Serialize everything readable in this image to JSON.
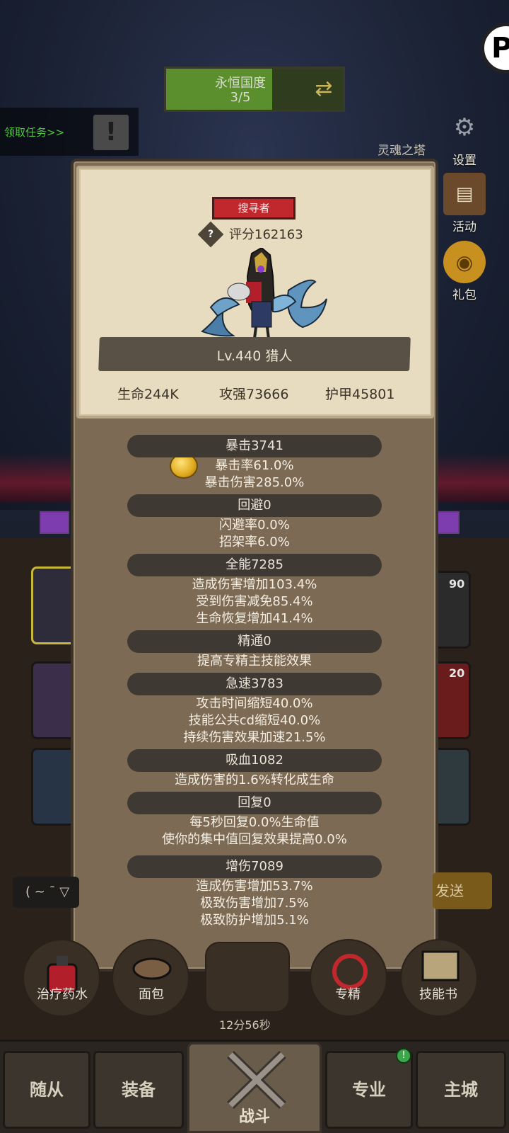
{
  "top": {
    "realm_name": "永恒国度",
    "realm_progress": "3/5",
    "realm_progress_fraction": 0.6,
    "quest_label": "领取任务>>",
    "quest_icon": "exclamation-icon",
    "tower_label": "灵魂之塔",
    "side_menu": [
      {
        "label": "设置",
        "icon": "gear-icon"
      },
      {
        "label": "活动",
        "icon": "scroll-icon"
      },
      {
        "label": "礼包",
        "icon": "gift-bag-icon"
      }
    ],
    "badge_letter": "P"
  },
  "hero_card": {
    "role": "搜寻者",
    "score": "评分162163",
    "help_icon": "?",
    "name_line": "Lv.440 猎人",
    "core_stats": [
      "生命244K",
      "攻强73666",
      "护甲45801"
    ]
  },
  "stat_groups": [
    {
      "title": "暴击3741",
      "lines": [
        "暴击率61.0%",
        "暴击伤害285.0%"
      ]
    },
    {
      "title": "回避0",
      "lines": [
        "闪避率0.0%",
        "招架率6.0%"
      ]
    },
    {
      "title": "全能7285",
      "lines": [
        "造成伤害增加103.4%",
        "受到伤害减免85.4%",
        "生命恢复增加41.4%"
      ]
    },
    {
      "title": "精通0",
      "lines": [
        "提高专精主技能效果"
      ]
    },
    {
      "title": "急速3783",
      "lines": [
        "攻击时间缩短40.0%",
        "技能公共cd缩短40.0%",
        "持续伤害效果加速21.5%"
      ]
    },
    {
      "title": "吸血1082",
      "lines": [
        "造成伤害的1.6%转化成生命"
      ]
    },
    {
      "title": "回复0",
      "lines": [
        "每5秒回复0.0%生命值",
        "使你的集中值回复效果提高0.0%"
      ]
    },
    {
      "title": "增伤7089",
      "lines": [
        "造成伤害增加53.7%",
        "极致伤害增加7.5%",
        "极致防护增加5.1%"
      ]
    }
  ],
  "behind": {
    "chat_text": "( ~ ¯ ▽",
    "send_label": "发送",
    "slot_numbers": [
      "90",
      "20"
    ],
    "consumables": [
      "治疗药水",
      "面包",
      "专精",
      "技能书"
    ],
    "timer": "12分56秒"
  },
  "nav": {
    "items": [
      "随从",
      "装备",
      "战斗",
      "专业",
      "主城"
    ],
    "badge": "!"
  }
}
